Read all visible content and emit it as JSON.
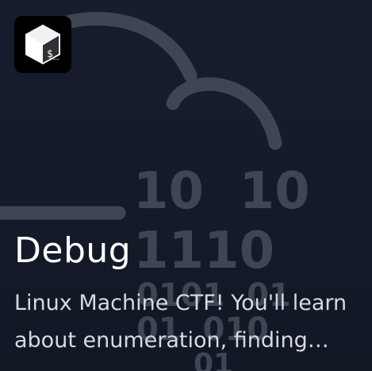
{
  "card": {
    "title": "Debug",
    "description": "Linux Machine CTF! You'll learn about enumeration, finding hidden password files and how to exploit php deserialization!",
    "logo_icon": "bash-terminal-icon",
    "logo_glyph": "$_"
  },
  "background": {
    "icon": "cloud-binary-icon",
    "bit_rows": [
      "10  10",
      "1110",
      "0101  01",
      "01  010",
      "01"
    ]
  },
  "colors": {
    "background": "#151b2b",
    "art": "#3e4553",
    "title": "#ffffff",
    "description": "#d7dae0"
  }
}
